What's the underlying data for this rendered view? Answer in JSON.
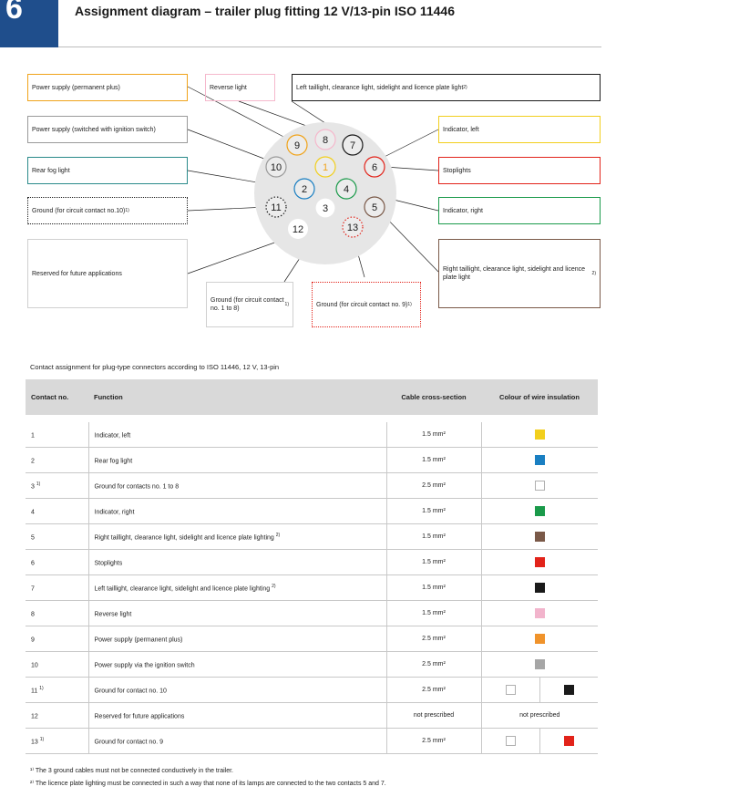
{
  "header": {
    "section_number": "6",
    "title": "Assignment diagram – trailer plug fitting 12 V/13-pin ISO 11446"
  },
  "callouts": {
    "power_perm": "Power supply (permanent plus)",
    "reverse": "Reverse light",
    "left_tail": "Left taillight, clearance light, sidelight and licence plate light",
    "left_tail_note": "2)",
    "power_ign": "Power supply (switched with ignition switch)",
    "indicator_left": "Indicator, left",
    "rear_fog": "Rear fog light",
    "stoplights": "Stoplights",
    "ground_10": "Ground (for circuit contact no.10)",
    "ground_10_note": "1)",
    "indicator_right": "Indicator, right",
    "reserved": "Reserved for future applications",
    "right_tail": "Right taillight, clearance light, sidelight and licence plate light",
    "right_tail_note": "2)",
    "ground_1_8": "Ground (for circuit contact no. 1 to 8)",
    "ground_1_8_note": "1)",
    "ground_9": "Ground (for circuit contact no. 9)",
    "ground_9_note": "1)"
  },
  "pins": [
    "1",
    "2",
    "3",
    "4",
    "5",
    "6",
    "7",
    "8",
    "9",
    "10",
    "11",
    "12",
    "13"
  ],
  "colors": {
    "yellow": "#f2cf1d",
    "blue": "#1a7fc2",
    "white": "#ffffff",
    "green": "#1a9a4a",
    "brown": "#7a5948",
    "red": "#e2231a",
    "black": "#1a1a1a",
    "pink": "#f2b4cc",
    "orange": "#f0932b",
    "grey": "#a6a6a6",
    "border_orange": "#f0a31a",
    "border_pink": "#f5b8cc",
    "border_yellow": "#f2cf1d",
    "border_teal": "#2a8a8a",
    "border_red": "#e2231a",
    "border_green": "#1a9a4a",
    "border_brown": "#7a5948",
    "border_grey": "#9a9a9a",
    "plug_face": "#e6e6e6"
  },
  "table": {
    "caption": "Contact assignment for plug-type connectors according to ISO 11446, 12 V, 13-pin",
    "headers": {
      "contact": "Contact no.",
      "function": "Function",
      "cable": "Cable cross-section",
      "colour": "Colour of wire insulation"
    },
    "rows": [
      {
        "contact": "1",
        "note": "",
        "function": "Indicator, left",
        "fnote": "",
        "cable": "1.5 mm²",
        "colors": [
          "yellow"
        ]
      },
      {
        "contact": "2",
        "note": "",
        "function": "Rear fog light",
        "fnote": "",
        "cable": "1.5 mm²",
        "colors": [
          "blue"
        ]
      },
      {
        "contact": "3",
        "note": "1)",
        "function": "Ground for contacts no. 1 to 8",
        "fnote": "",
        "cable": "2.5 mm²",
        "colors": [
          "white"
        ]
      },
      {
        "contact": "4",
        "note": "",
        "function": "Indicator, right",
        "fnote": "",
        "cable": "1.5 mm²",
        "colors": [
          "green"
        ]
      },
      {
        "contact": "5",
        "note": "",
        "function": "Right taillight, clearance light, sidelight and licence plate lighting",
        "fnote": "2)",
        "cable": "1.5 mm²",
        "colors": [
          "brown"
        ]
      },
      {
        "contact": "6",
        "note": "",
        "function": "Stoplights",
        "fnote": "",
        "cable": "1.5 mm²",
        "colors": [
          "red"
        ]
      },
      {
        "contact": "7",
        "note": "",
        "function": "Left taillight, clearance light, sidelight and licence plate lighting",
        "fnote": "2)",
        "cable": "1.5 mm²",
        "colors": [
          "black"
        ]
      },
      {
        "contact": "8",
        "note": "",
        "function": "Reverse light",
        "fnote": "",
        "cable": "1.5 mm²",
        "colors": [
          "pink"
        ]
      },
      {
        "contact": "9",
        "note": "",
        "function": "Power supply (permanent plus)",
        "fnote": "",
        "cable": "2.5 mm²",
        "colors": [
          "orange"
        ]
      },
      {
        "contact": "10",
        "note": "",
        "function": "Power supply via the ignition switch",
        "fnote": "",
        "cable": "2.5 mm²",
        "colors": [
          "grey"
        ]
      },
      {
        "contact": "11",
        "note": "1)",
        "function": "Ground for contact no. 10",
        "fnote": "",
        "cable": "2.5 mm²",
        "colors": [
          "white",
          "black"
        ]
      },
      {
        "contact": "12",
        "note": "",
        "function": "Reserved for future applications",
        "fnote": "",
        "cable": "not prescribed",
        "colors": [],
        "colour_text": "not prescribed"
      },
      {
        "contact": "13",
        "note": "1)",
        "function": "Ground for contact no. 9",
        "fnote": "",
        "cable": "2.5 mm²",
        "colors": [
          "white",
          "red"
        ]
      }
    ]
  },
  "footnotes": {
    "n1": "¹⁾ The 3 ground cables must not be connected conductively in the trailer.",
    "n2": "²⁾ The licence plate lighting must be connected in such a way that none of its lamps are connected to the two contacts 5 and 7."
  }
}
